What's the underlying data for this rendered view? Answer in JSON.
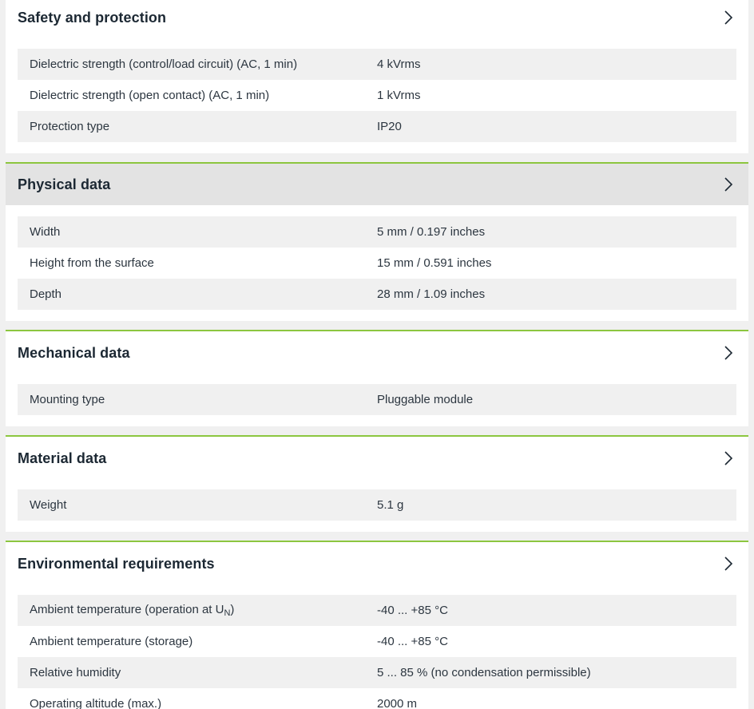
{
  "sections": [
    {
      "title": "Safety and protection",
      "rows": [
        {
          "label": "Dielectric strength (control/load circuit) (AC, 1 min)",
          "value": "4 kVrms"
        },
        {
          "label": "Dielectric strength (open contact) (AC, 1 min)",
          "value": "1 kVrms"
        },
        {
          "label": "Protection type",
          "value": "IP20"
        }
      ]
    },
    {
      "title": "Physical data",
      "rows": [
        {
          "label": "Width",
          "value": "5 mm / 0.197 inches"
        },
        {
          "label": "Height from the surface",
          "value": "15 mm / 0.591 inches"
        },
        {
          "label": "Depth",
          "value": "28 mm / 1.09 inches"
        }
      ]
    },
    {
      "title": "Mechanical data",
      "rows": [
        {
          "label": "Mounting type",
          "value": "Pluggable module"
        }
      ]
    },
    {
      "title": "Material data",
      "rows": [
        {
          "label": "Weight",
          "value": "5.1 g"
        }
      ]
    },
    {
      "title": "Environmental requirements",
      "rows": [
        {
          "label": "Ambient temperature (operation at U",
          "label_sub": "N",
          "label_suffix": ")",
          "value": "-40 ... +85 °C"
        },
        {
          "label": "Ambient temperature (storage)",
          "value": "-40 ... +85 °C"
        },
        {
          "label": "Relative humidity",
          "value": "5 ... 85 % (no condensation permissible)"
        },
        {
          "label": "Operating altitude (max.)",
          "value": "2000 m"
        }
      ]
    }
  ],
  "colors": {
    "accent_border": "#8cc63f",
    "active_header_bg": "#e3e3e3",
    "row_shade": "#f0f0f0"
  },
  "icons": {
    "expand": "chevron-right-icon"
  }
}
